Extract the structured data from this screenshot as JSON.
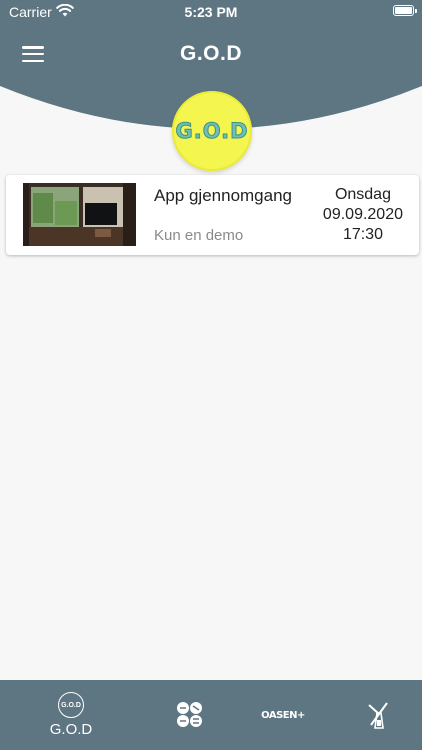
{
  "status_bar": {
    "carrier": "Carrier",
    "time": "5:23 PM"
  },
  "header": {
    "title": "G.O.D",
    "logo_text": "G.O.D",
    "menu_icon": "hamburger-menu-icon"
  },
  "colors": {
    "header_bg": "#5e7682",
    "logo_bg": "#f5f550",
    "page_bg": "#f7f7f7"
  },
  "events": [
    {
      "title": "App gjennomgang",
      "subtitle": "Kun en demo",
      "day": "Onsdag",
      "date": "09.09.2020",
      "time": "17:30"
    }
  ],
  "tabbar": {
    "items": [
      {
        "label": "G.O.D",
        "icon": "god-logo-icon",
        "icon_text": "G.O.D"
      },
      {
        "label": "",
        "icon": "collage-logo-icon"
      },
      {
        "label": "",
        "icon": "oasen-logo-icon",
        "icon_text": "OASEN+"
      },
      {
        "label": "",
        "icon": "windmill-logo-icon"
      }
    ]
  }
}
